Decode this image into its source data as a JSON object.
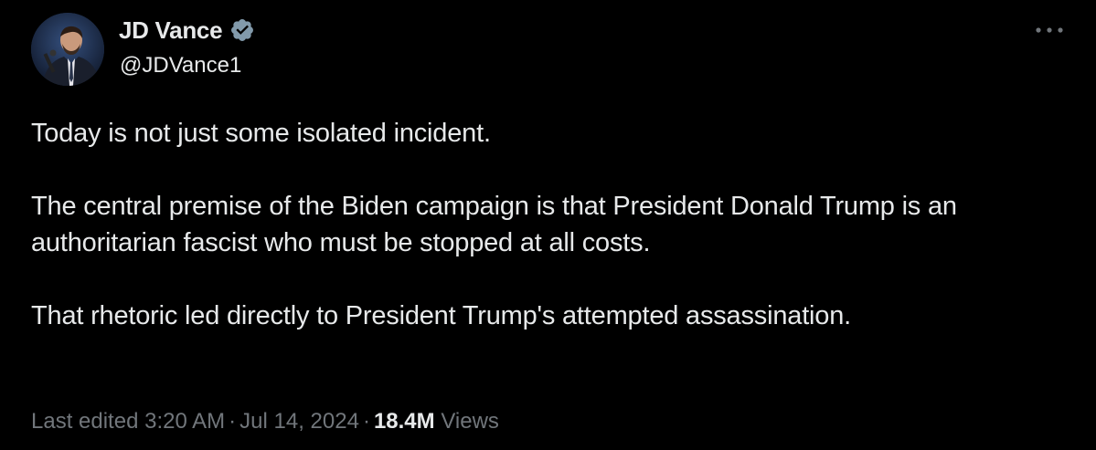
{
  "author": {
    "display_name": "JD Vance",
    "handle": "@JDVance1",
    "verified": true,
    "avatar_icon": "user-avatar-photo"
  },
  "menu": {
    "more_icon": "more-horizontal-icon"
  },
  "tweet": {
    "paragraphs": [
      "Today is not just some isolated incident.",
      "The central premise of the Biden campaign is that President Donald Trump is an authoritarian fascist who must be stopped at all costs.",
      "That rhetoric led directly to President Trump's attempted assassination."
    ]
  },
  "meta": {
    "edited_label": "Last edited 3:20 AM",
    "separator": "·",
    "date": "Jul 14, 2024",
    "views_count": "18.4M",
    "views_label": "Views"
  },
  "colors": {
    "background": "#000000",
    "text_primary": "#e7e9ea",
    "text_secondary": "#71767b",
    "verified_badge": "#829aab"
  }
}
